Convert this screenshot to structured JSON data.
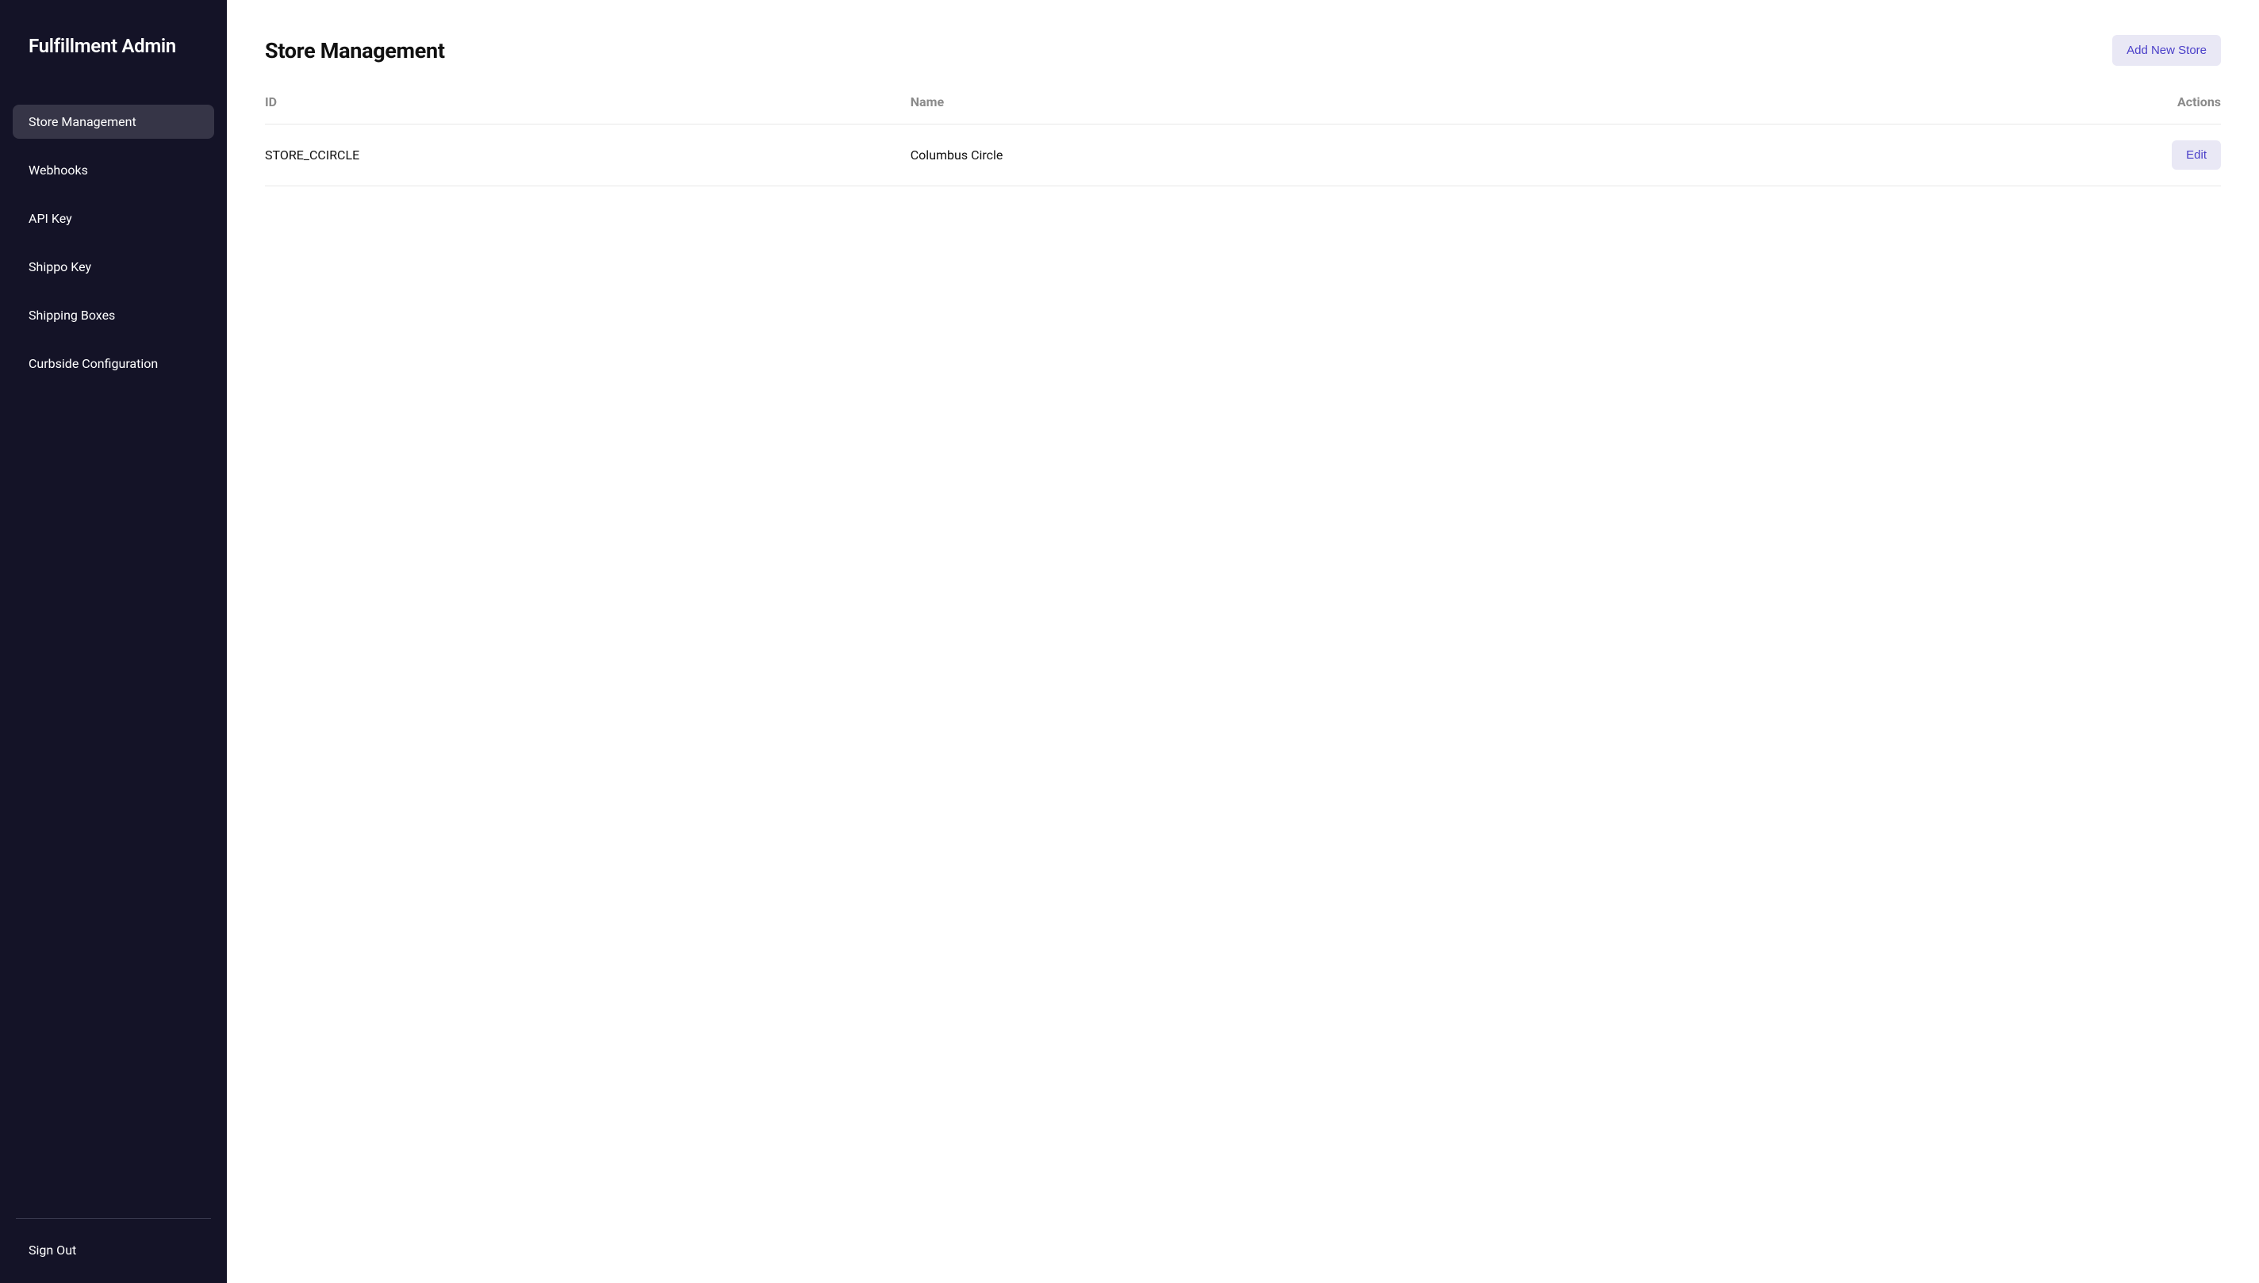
{
  "sidebar": {
    "title": "Fulfillment Admin",
    "items": [
      {
        "label": "Store Management",
        "active": true
      },
      {
        "label": "Webhooks",
        "active": false
      },
      {
        "label": "API Key",
        "active": false
      },
      {
        "label": "Shippo Key",
        "active": false
      },
      {
        "label": "Shipping Boxes",
        "active": false
      },
      {
        "label": "Curbside Configuration",
        "active": false
      }
    ],
    "sign_out_label": "Sign Out"
  },
  "main": {
    "page_title": "Store Management",
    "add_button_label": "Add New Store",
    "table": {
      "columns": [
        {
          "label": "ID"
        },
        {
          "label": "Name"
        },
        {
          "label": "Actions"
        }
      ],
      "rows": [
        {
          "id": "STORE_CCIRCLE",
          "name": "Columbus Circle",
          "edit_label": "Edit"
        }
      ]
    }
  }
}
